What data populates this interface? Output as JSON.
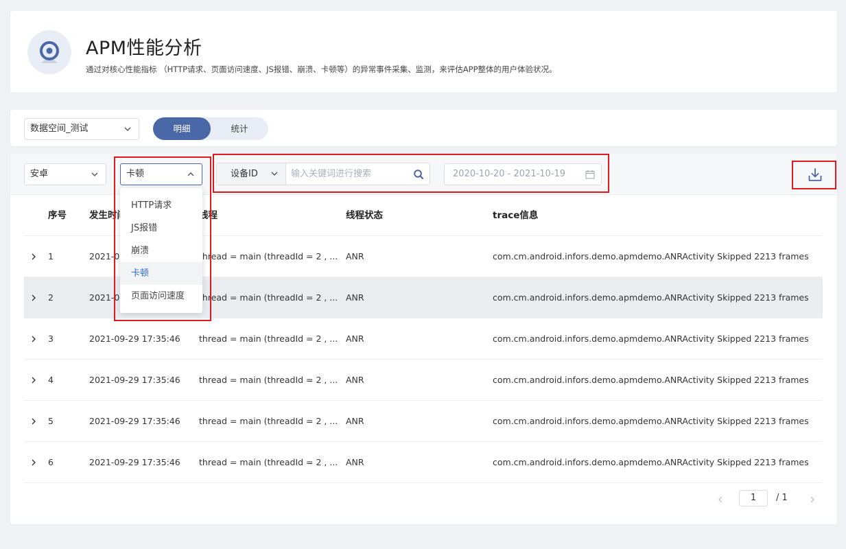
{
  "header": {
    "title": "APM性能分析",
    "description": "通过对核心性能指标 （HTTP请求、页面访问速度、JS报错、崩溃、卡顿等）的异常事件采集、监测，来评估APP整体的用户体验状况。",
    "logo_icon": "location-pin-icon"
  },
  "toolbar": {
    "dataspace_value": "数据空间_测试",
    "tabs": [
      {
        "label": "明细",
        "active": true
      },
      {
        "label": "统计",
        "active": false
      }
    ]
  },
  "filters": {
    "platform_value": "安卓",
    "type_value": "卡顿",
    "type_options": [
      "HTTP请求",
      "JS报错",
      "崩溃",
      "卡顿",
      "页面访问速度"
    ],
    "search_field_value": "设备ID",
    "search_placeholder": "输入关键词进行搜索",
    "date_range": "2020-10-20 - 2021-10-19"
  },
  "table": {
    "headers": [
      "序号",
      "发生时间",
      "线程",
      "线程状态",
      "trace信息"
    ],
    "rows": [
      {
        "no": "1",
        "time": "2021-09-29 17:35:46",
        "thread": "thread = main (threadId = 2 , ...",
        "state": "ANR",
        "trace": "com.cm.android.infors.demo.apmdemo.ANRActivity Skipped 2213 frames"
      },
      {
        "no": "2",
        "time": "2021-09-29 17:35:46",
        "thread": "thread = main (threadId = 2 , ...",
        "state": "ANR",
        "trace": "com.cm.android.infors.demo.apmdemo.ANRActivity Skipped 2213 frames"
      },
      {
        "no": "3",
        "time": "2021-09-29 17:35:46",
        "thread": "thread = main (threadId = 2 , ...",
        "state": "ANR",
        "trace": "com.cm.android.infors.demo.apmdemo.ANRActivity Skipped 2213 frames"
      },
      {
        "no": "4",
        "time": "2021-09-29 17:35:46",
        "thread": "thread = main (threadId = 2 , ...",
        "state": "ANR",
        "trace": "com.cm.android.infors.demo.apmdemo.ANRActivity Skipped 2213 frames"
      },
      {
        "no": "5",
        "time": "2021-09-29 17:35:46",
        "thread": "thread = main (threadId = 2 , ...",
        "state": "ANR",
        "trace": "com.cm.android.infors.demo.apmdemo.ANRActivity Skipped 2213 frames"
      },
      {
        "no": "6",
        "time": "2021-09-29 17:35:46",
        "thread": "thread = main (threadId = 2 , ...",
        "state": "ANR",
        "trace": "com.cm.android.infors.demo.apmdemo.ANRActivity Skipped 2213 frames"
      }
    ]
  },
  "pagination": {
    "current": "1",
    "total": "/ 1"
  },
  "colors": {
    "accent": "#4a67a8",
    "highlight_border": "#e0191e",
    "active_option": "#2f6fd6"
  }
}
